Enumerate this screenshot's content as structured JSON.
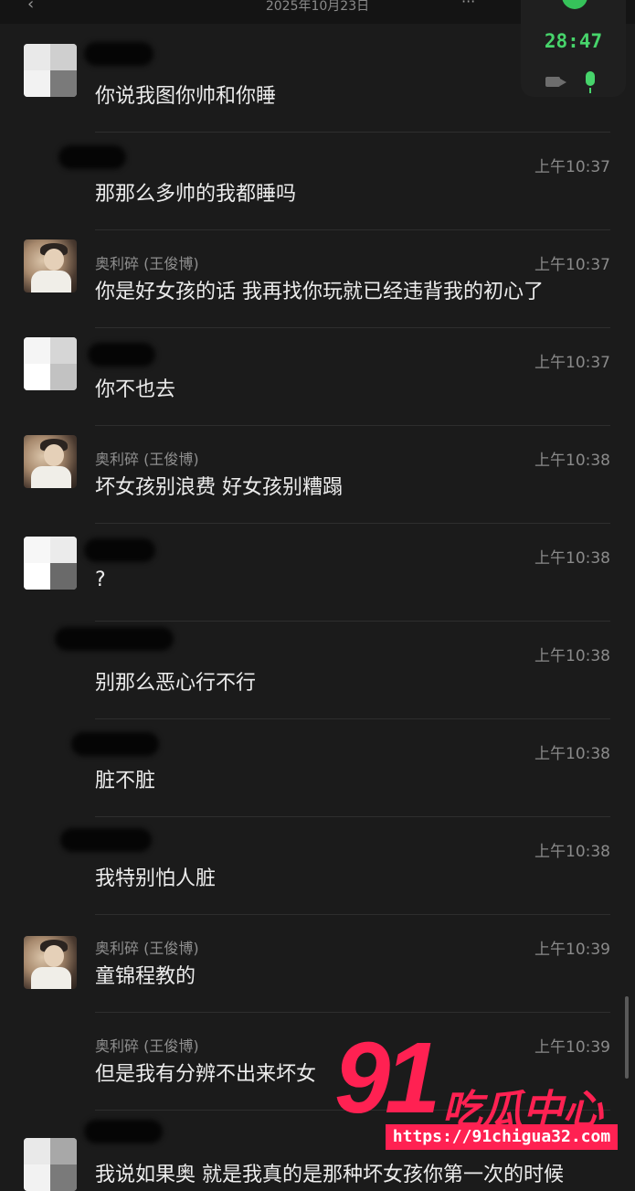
{
  "header": {
    "date": "2025年10月23日",
    "left_glyph": "‹",
    "right_glyph": "···"
  },
  "call": {
    "timer": "28:47"
  },
  "messages": [
    {
      "sender": "",
      "time": "",
      "text": "你说我图你帅和你睡"
    },
    {
      "sender": "",
      "time": "上午10:37",
      "text": "那那么多帅的我都睡吗"
    },
    {
      "sender": "奥利碎 (王俊博)",
      "time": "上午10:37",
      "text": "你是好女孩的话 我再找你玩就已经违背我的初心了"
    },
    {
      "sender": "",
      "time": "上午10:37",
      "text": "你不也去"
    },
    {
      "sender": "奥利碎 (王俊博)",
      "time": "上午10:38",
      "text": "坏女孩别浪费 好女孩别糟蹋"
    },
    {
      "sender": "",
      "time": "上午10:38",
      "text": "?"
    },
    {
      "sender": "",
      "time": "上午10:38",
      "text": "别那么恶心行不行"
    },
    {
      "sender": "",
      "time": "上午10:38",
      "text": "脏不脏"
    },
    {
      "sender": "",
      "time": "上午10:38",
      "text": "我特别怕人脏"
    },
    {
      "sender": "奥利碎 (王俊博)",
      "time": "上午10:39",
      "text": "童锦程教的"
    },
    {
      "sender": "奥利碎 (王俊博)",
      "time": "上午10:39",
      "text": "但是我有分辨不出来坏女"
    },
    {
      "sender": "",
      "time": "",
      "text": "我说如果奥 就是我真的是那种坏女孩你第一次的时候"
    }
  ],
  "watermark": {
    "number": "91",
    "brand": "吃瓜中心",
    "url": "https://91chigua32.com"
  }
}
